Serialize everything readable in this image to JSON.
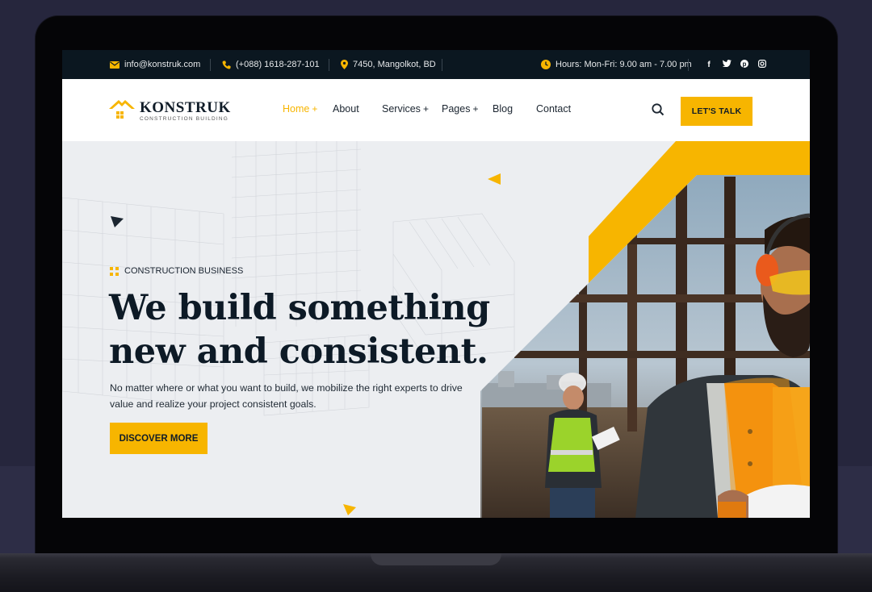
{
  "topbar": {
    "email": "info@konstruk.com",
    "phone": "(+088) 1618-287-101",
    "address": "7450, Mangolkot, BD",
    "hours": "Hours: Mon-Fri: 9.00 am - 7.00 pm",
    "social_icons": [
      "facebook-icon",
      "twitter-icon",
      "pinterest-icon",
      "instagram-icon"
    ],
    "social_glyphs": [
      "f",
      "t",
      "p",
      "◎"
    ]
  },
  "nav": {
    "logo_name": "KONSTRUK",
    "logo_tagline": "CONSTRUCTION BUILDING",
    "items": [
      {
        "label": "Home",
        "has_submenu": true,
        "active": true
      },
      {
        "label": "About",
        "has_submenu": false,
        "active": false
      },
      {
        "label": "Services",
        "has_submenu": true,
        "active": false
      },
      {
        "label": "Pages",
        "has_submenu": true,
        "active": false
      },
      {
        "label": "Blog",
        "has_submenu": false,
        "active": false
      },
      {
        "label": "Contact",
        "has_submenu": false,
        "active": false
      }
    ],
    "submenu_marker": "+",
    "cta_label": "LET'S TALK"
  },
  "hero": {
    "eyebrow": "CONSTRUCTION BUSINESS",
    "headline_line1": "We build something",
    "headline_line2": "new and consistent.",
    "description": "No matter where or what you want to build, we mobilize the right experts to drive value and realize your project consistent goals.",
    "button_label": "DISCOVER MORE"
  },
  "colors": {
    "accent": "#f7b500",
    "topbar_bg": "#0b1720",
    "heading": "#0d1a26",
    "hero_bg": "#eceef1",
    "page_bg": "#26263d"
  }
}
